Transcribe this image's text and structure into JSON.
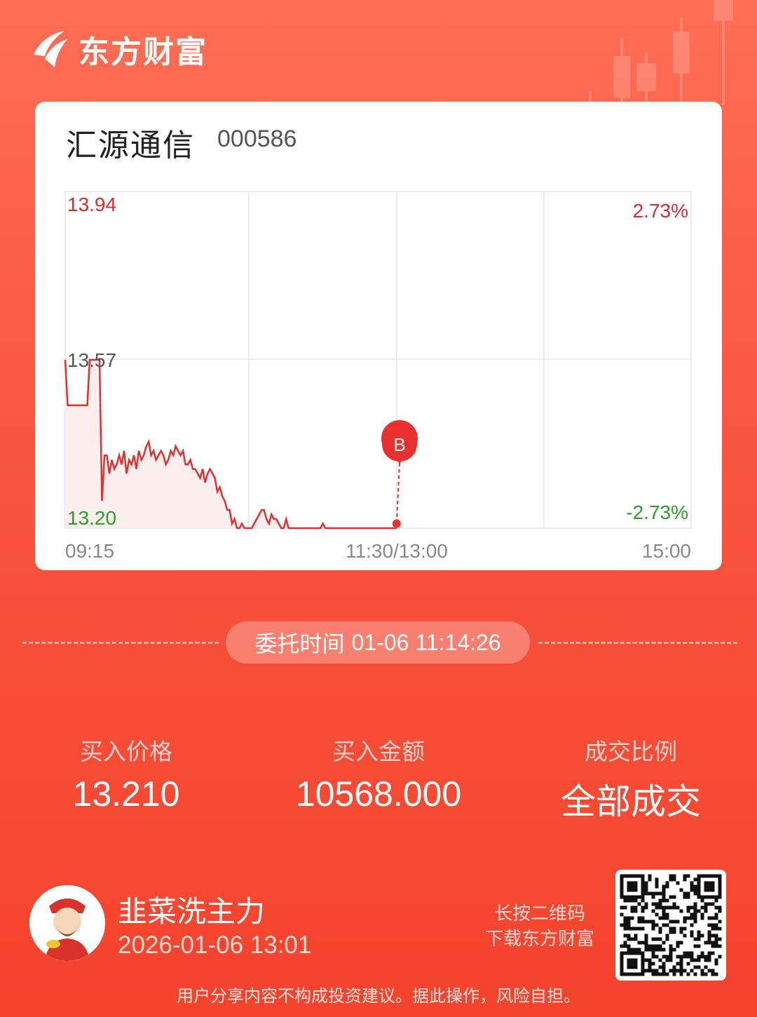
{
  "app": {
    "brand": "东方财富"
  },
  "stock": {
    "name": "汇源通信",
    "code": "000586"
  },
  "chart_data": {
    "type": "line",
    "price_labels": {
      "high": "13.94",
      "mid": "13.57",
      "low": "13.20"
    },
    "pct_labels": {
      "high": "2.73%",
      "low": "-2.73%"
    },
    "time_labels": [
      "09:15",
      "11:30/13:00",
      "15:00"
    ],
    "ylim": [
      13.2,
      13.94
    ],
    "x_unit": "minutes since 09:15",
    "xlim": [
      0,
      255
    ],
    "x": [
      0,
      1,
      2,
      3,
      4,
      5,
      6,
      7,
      8,
      9,
      10,
      11,
      12,
      13,
      14,
      15,
      16,
      17,
      18,
      19,
      20,
      21,
      22,
      23,
      24,
      25,
      26,
      27,
      28,
      29,
      30,
      31,
      32,
      33,
      34,
      35,
      36,
      37,
      38,
      39,
      40,
      41,
      42,
      43,
      44,
      45,
      46,
      47,
      48,
      49,
      50,
      51,
      52,
      53,
      54,
      55,
      56,
      57,
      58,
      59,
      60,
      61,
      62,
      63,
      64,
      65,
      66,
      67,
      68,
      69,
      70,
      71,
      72,
      73,
      74,
      75,
      76,
      77,
      78,
      79,
      80,
      81,
      82,
      83,
      84,
      85,
      86,
      87,
      88,
      89,
      90,
      91,
      92,
      93,
      94,
      95,
      96,
      97,
      98,
      99,
      100,
      101,
      102,
      103,
      104,
      105,
      106,
      107,
      108,
      109,
      110,
      111,
      112,
      113,
      114,
      115,
      116,
      117,
      118,
      119,
      120,
      121,
      122,
      123,
      124,
      125,
      126,
      127,
      128,
      129,
      130,
      131,
      132,
      133,
      134,
      135
    ],
    "values": [
      13.57,
      13.47,
      13.47,
      13.47,
      13.47,
      13.47,
      13.47,
      13.47,
      13.47,
      13.47,
      13.57,
      13.57,
      13.57,
      13.57,
      13.57,
      13.26,
      13.36,
      13.36,
      13.32,
      13.35,
      13.33,
      13.34,
      13.36,
      13.34,
      13.37,
      13.32,
      13.35,
      13.34,
      13.36,
      13.33,
      13.37,
      13.35,
      13.36,
      13.38,
      13.39,
      13.36,
      13.37,
      13.35,
      13.36,
      13.37,
      13.36,
      13.34,
      13.35,
      13.37,
      13.36,
      13.38,
      13.37,
      13.36,
      13.37,
      13.34,
      13.34,
      13.35,
      13.33,
      13.33,
      13.32,
      13.31,
      13.33,
      13.3,
      13.32,
      13.33,
      13.32,
      13.31,
      13.28,
      13.29,
      13.27,
      13.26,
      13.24,
      13.24,
      13.21,
      13.22,
      13.2,
      13.19,
      13.21,
      13.2,
      13.19,
      13.2,
      13.19,
      13.21,
      13.22,
      13.23,
      13.24,
      13.24,
      13.22,
      13.21,
      13.23,
      13.22,
      13.22,
      13.21,
      13.2,
      13.2,
      13.22,
      13.2,
      13.19,
      13.18,
      13.19,
      13.19,
      13.19,
      13.18,
      13.19,
      13.18,
      13.19,
      13.2,
      13.19,
      13.2,
      13.19,
      13.21,
      13.19,
      13.18,
      13.2,
      13.19,
      13.18,
      13.18,
      13.18,
      13.18,
      13.19,
      13.18,
      13.17,
      13.18,
      13.17,
      13.18,
      13.19,
      13.18,
      13.18,
      13.19,
      13.19,
      13.18,
      13.17,
      13.18,
      13.17,
      13.18,
      13.17,
      13.17,
      13.18,
      13.18,
      13.19,
      13.19
    ],
    "marker": {
      "label": "B",
      "x": 135,
      "y": 13.21
    },
    "colors": {
      "line": "#e03030",
      "up": "#d32f2f",
      "down": "#2a9d2a",
      "marker": "#e8312f"
    }
  },
  "order": {
    "label": "委托时间",
    "time": "01-06 11:14:26"
  },
  "stats": [
    {
      "label": "买入价格",
      "value": "13.210"
    },
    {
      "label": "买入金额",
      "value": "10568.000"
    },
    {
      "label": "成交比例",
      "value": "全部成交"
    }
  ],
  "user": {
    "name": "韭菜洗主力",
    "timestamp": "2026-01-06 13:01"
  },
  "qr": {
    "hint_line1": "长按二维码",
    "hint_line2": "下载东方财富"
  },
  "disclaimer": "用户分享内容不构成投资建议。据此操作，风险自担。"
}
